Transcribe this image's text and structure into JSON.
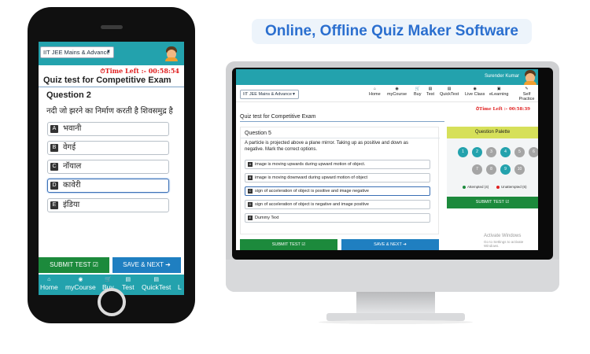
{
  "banner": {
    "title": "Online, Offline Quiz Maker Software"
  },
  "mobile": {
    "course_select": "IIT JEE Mains & Advance",
    "timer_label": "⏱Time Left :-",
    "timer_value": "00:58:54",
    "quiz_title": "Quiz test for Competitive Exam",
    "question_label": "Question 2",
    "question_text": "नदी जो झरने का निर्माण करती है शिवसमुद्र है",
    "options": [
      {
        "letter": "A",
        "text": "भवानी"
      },
      {
        "letter": "B",
        "text": "वेगई"
      },
      {
        "letter": "C",
        "text": "नॉयाल"
      },
      {
        "letter": "D",
        "text": "कावेरी"
      },
      {
        "letter": "E",
        "text": "इंडिया"
      }
    ],
    "submit_label": "SUBMIT TEST ☑",
    "save_next_label": "SAVE & NEXT ➔",
    "nav": [
      {
        "icon": "home-icon",
        "label": "Home"
      },
      {
        "icon": "course-icon",
        "label": "myCourse"
      },
      {
        "icon": "cart-icon",
        "label": "Buy"
      },
      {
        "icon": "test-icon",
        "label": "Test"
      },
      {
        "icon": "quicktest-icon",
        "label": "QuickTest"
      },
      {
        "icon": "live-icon",
        "label": "L"
      }
    ]
  },
  "desktop": {
    "course_select": "IIT JEE Mains & Advance",
    "user_name": "Surender Kumar",
    "nav": [
      {
        "icon": "home-icon",
        "label": "Home"
      },
      {
        "icon": "course-icon",
        "label": "myCourse"
      },
      {
        "icon": "cart-icon",
        "label": "Buy"
      },
      {
        "icon": "test-icon",
        "label": "Test"
      },
      {
        "icon": "quicktest-icon",
        "label": "QuickTest"
      },
      {
        "icon": "live-class-icon",
        "label": "Live Class"
      },
      {
        "icon": "elearning-icon",
        "label": "eLearning"
      },
      {
        "icon": "self-practice-icon",
        "label": "Self Practice"
      }
    ],
    "timer_label": "⏱Time Left :-",
    "timer_value": "00:58:39",
    "quiz_title": "Quiz test for Competitive Exam",
    "question_label": "Question 5",
    "question_text": "A particle is projected above a plane mirror. Taking up as positive and down as negative. Mark the correct options.",
    "options": [
      {
        "letter": "A",
        "text": "image is moving upwards during upward motion of object."
      },
      {
        "letter": "B",
        "text": "image is moving downward during upward motion of object"
      },
      {
        "letter": "C",
        "text": "sign of acceleration of object is positive and image negative"
      },
      {
        "letter": "D",
        "text": "sign of acceleration of object is negative and image positive"
      },
      {
        "letter": "E",
        "text": "Dummy Text"
      }
    ],
    "submit_label": "SUBMIT TEST ☑",
    "save_next_label": "SAVE & NEXT ➔",
    "palette": {
      "title": "Question Palette",
      "bubbles": [
        {
          "n": "1",
          "state": "attempted"
        },
        {
          "n": "2",
          "state": "attempted"
        },
        {
          "n": "3",
          "state": "unattempted"
        },
        {
          "n": "4",
          "state": "attempted"
        },
        {
          "n": "5",
          "state": "unattempted"
        },
        {
          "n": "6",
          "state": "unattempted"
        },
        {
          "n": "7",
          "state": "unattempted"
        },
        {
          "n": "8",
          "state": "unattempted"
        },
        {
          "n": "9",
          "state": "attempted"
        },
        {
          "n": "10",
          "state": "unattempted"
        }
      ],
      "attempted_label": "Attempted (4)",
      "unattempted_label": "Unattempted (6)",
      "attempted_color": "#1c8a3c",
      "unattempted_color": "#e02020",
      "submit_label": "SUBMIT TEST ☑"
    },
    "activate_title": "Activate Windows",
    "activate_sub": "Go to Settings to activate Windows."
  }
}
